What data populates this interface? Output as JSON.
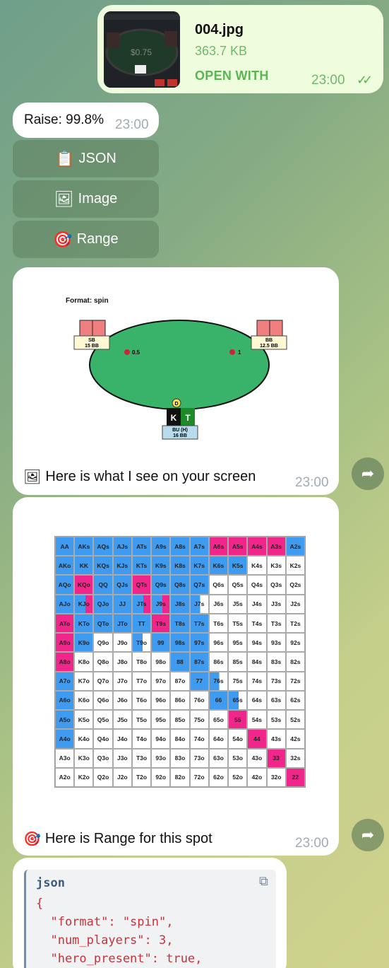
{
  "file_message": {
    "name": "004.jpg",
    "size": "363.7 KB",
    "action": "OPEN WITH",
    "time": "23:00",
    "thumb_text": "$0.75"
  },
  "raise_message": {
    "text": "Raise: 99.8%",
    "time": "23:00"
  },
  "keyboard": [
    {
      "label": "JSON",
      "icon": "clipboard-icon"
    },
    {
      "label": "Image",
      "icon": "picture-icon"
    },
    {
      "label": "Range",
      "icon": "dart-icon"
    }
  ],
  "image_message": {
    "caption": "Here is what I see on your screen",
    "time": "23:00",
    "table": {
      "format": "Format: spin",
      "sb": {
        "name": "SB",
        "stack": "15 BB",
        "bet": "0.5"
      },
      "bb": {
        "name": "BB",
        "stack": "12.5 BB",
        "bet": "1"
      },
      "bu": {
        "name": "BU (H)",
        "stack": "16 BB"
      },
      "dealer": "D",
      "cards": [
        "K",
        "T"
      ]
    }
  },
  "range_message": {
    "caption": "Here is Range for this spot",
    "time": "23:00"
  },
  "range": {
    "cells": [
      [
        "AA",
        "AKs",
        "AQs",
        "AJs",
        "ATs",
        "A9s",
        "A8s",
        "A7s",
        "A6s",
        "A5s",
        "A4s",
        "A3s",
        "A2s"
      ],
      [
        "AKo",
        "KK",
        "KQs",
        "KJs",
        "KTs",
        "K9s",
        "K8s",
        "K7s",
        "K6s",
        "K5s",
        "K4s",
        "K3s",
        "K2s"
      ],
      [
        "AQo",
        "KQo",
        "QQ",
        "QJs",
        "QTs",
        "Q9s",
        "Q8s",
        "Q7s",
        "Q6s",
        "Q5s",
        "Q4s",
        "Q3s",
        "Q2s"
      ],
      [
        "AJo",
        "KJo",
        "QJo",
        "JJ",
        "JTs",
        "J9s",
        "J8s",
        "J7s",
        "J6s",
        "J5s",
        "J4s",
        "J3s",
        "J2s"
      ],
      [
        "ATo",
        "KTo",
        "QTo",
        "JTo",
        "TT",
        "T9s",
        "T8s",
        "T7s",
        "T6s",
        "T5s",
        "T4s",
        "T3s",
        "T2s"
      ],
      [
        "A9o",
        "K9o",
        "Q9o",
        "J9o",
        "T9o",
        "99",
        "98s",
        "97s",
        "96s",
        "95s",
        "94s",
        "93s",
        "92s"
      ],
      [
        "A8o",
        "K8o",
        "Q8o",
        "J8o",
        "T8o",
        "98o",
        "88",
        "87s",
        "86s",
        "85s",
        "84s",
        "83s",
        "82s"
      ],
      [
        "A7o",
        "K7o",
        "Q7o",
        "J7o",
        "T7o",
        "97o",
        "87o",
        "77",
        "76s",
        "75s",
        "74s",
        "73s",
        "72s"
      ],
      [
        "A6o",
        "K6o",
        "Q6o",
        "J6o",
        "T6o",
        "96o",
        "86o",
        "76o",
        "66",
        "65s",
        "64s",
        "63s",
        "62s"
      ],
      [
        "A5o",
        "K5o",
        "Q5o",
        "J5o",
        "T5o",
        "95o",
        "85o",
        "75o",
        "65o",
        "55",
        "54s",
        "53s",
        "52s"
      ],
      [
        "A4o",
        "K4o",
        "Q4o",
        "J4o",
        "T4o",
        "94o",
        "84o",
        "74o",
        "64o",
        "54o",
        "44",
        "43s",
        "42s"
      ],
      [
        "A3o",
        "K3o",
        "Q3o",
        "J3o",
        "T3o",
        "93o",
        "83o",
        "73o",
        "63o",
        "53o",
        "43o",
        "33",
        "32s"
      ],
      [
        "A2o",
        "K2o",
        "Q2o",
        "J2o",
        "T2o",
        "92o",
        "82o",
        "72o",
        "62o",
        "52o",
        "42o",
        "32o",
        "22"
      ]
    ],
    "colors": [
      [
        "r",
        "r",
        "r",
        "r",
        "r",
        "r",
        "r",
        "r",
        "j",
        "j",
        "j",
        "j",
        "r"
      ],
      [
        "r",
        "r",
        "r",
        "r",
        "r",
        "r",
        "r",
        "r",
        "r",
        "r",
        "w",
        "w",
        "w"
      ],
      [
        "r",
        "j",
        "r",
        "r",
        "j",
        "r",
        "r",
        "r",
        "w",
        "w",
        "w",
        "w",
        "w"
      ],
      [
        "r",
        "mj",
        "r",
        "r",
        "mj",
        "mj",
        "r",
        "mb",
        "w",
        "w",
        "w",
        "w",
        "w"
      ],
      [
        "j",
        "r",
        "r",
        "r",
        "r",
        "j",
        "r",
        "r",
        "w",
        "w",
        "w",
        "w",
        "w"
      ],
      [
        "j",
        "r",
        "w",
        "w",
        "mb",
        "r",
        "r",
        "r",
        "w",
        "w",
        "w",
        "w",
        "w"
      ],
      [
        "j",
        "w",
        "w",
        "w",
        "w",
        "w",
        "r",
        "r",
        "w",
        "w",
        "w",
        "w",
        "w"
      ],
      [
        "r",
        "w",
        "w",
        "w",
        "w",
        "w",
        "w",
        "r",
        "mb",
        "w",
        "w",
        "w",
        "w"
      ],
      [
        "r",
        "w",
        "w",
        "w",
        "w",
        "w",
        "w",
        "w",
        "r",
        "mb",
        "w",
        "w",
        "w"
      ],
      [
        "r",
        "w",
        "w",
        "w",
        "w",
        "w",
        "w",
        "w",
        "w",
        "j",
        "w",
        "w",
        "w"
      ],
      [
        "r",
        "w",
        "w",
        "w",
        "w",
        "w",
        "w",
        "w",
        "w",
        "w",
        "j",
        "w",
        "w"
      ],
      [
        "w",
        "w",
        "w",
        "w",
        "w",
        "w",
        "w",
        "w",
        "w",
        "w",
        "w",
        "j",
        "w"
      ],
      [
        "w",
        "w",
        "w",
        "w",
        "w",
        "w",
        "w",
        "w",
        "w",
        "w",
        "w",
        "w",
        "j"
      ]
    ],
    "legend_colors": {
      "raise": "#3f9bf0",
      "jam": "#f0268a",
      "fold": "#ffffff"
    }
  },
  "json_message": {
    "lang": "json",
    "lines": [
      "{",
      "  \"format\": \"spin\",",
      "  \"num_players\": 3,",
      "  \"hero_present\": true,"
    ]
  }
}
